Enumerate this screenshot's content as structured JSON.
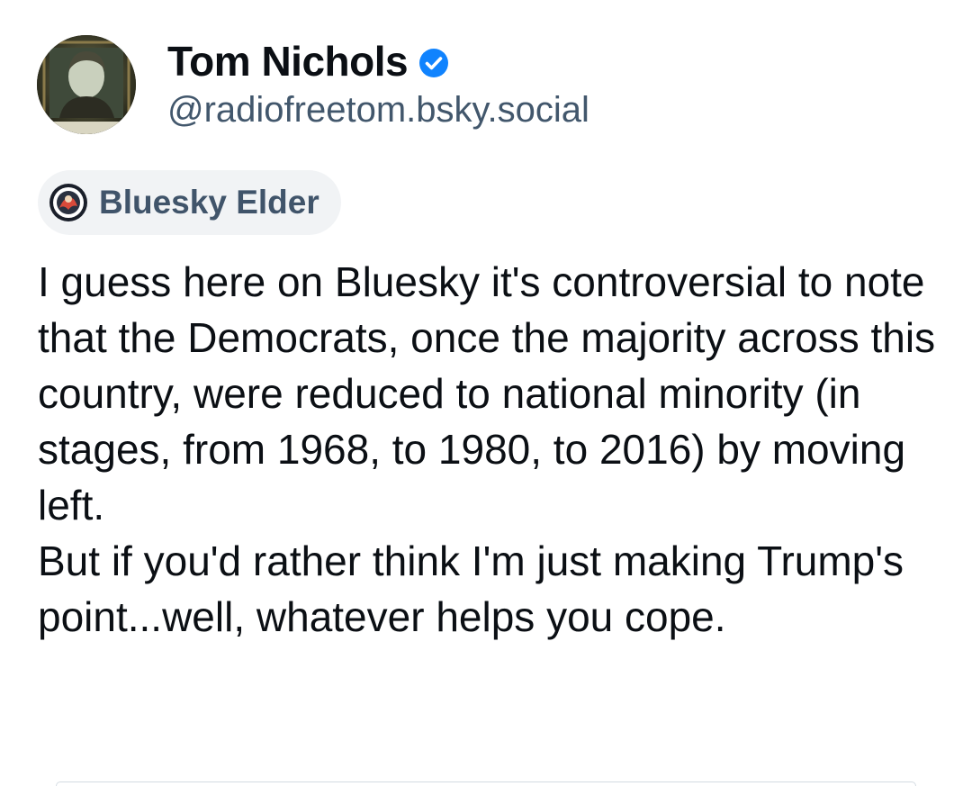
{
  "author": {
    "display_name": "Tom Nichols",
    "handle": "@radiofreetom.bsky.social",
    "verified": true,
    "verified_color": "#1083fe",
    "avatar": "avatar-photo"
  },
  "badge": {
    "label": "Bluesky Elder",
    "icon": "bluesky-elder-icon"
  },
  "post": {
    "text_line_1": "I guess here on Bluesky it's controversial to note that the Democrats, once the majority across this country, were reduced to national minority (in stages, from 1968, to 1980, to 2016) by moving left.",
    "text_line_2": "But if you'd rather think I'm just making Trump's point...well, whatever helps you cope."
  },
  "colors": {
    "text": "#0b0f14",
    "muted": "#42576c",
    "badge_bg": "#f1f3f5",
    "badge_text": "#40546a"
  }
}
